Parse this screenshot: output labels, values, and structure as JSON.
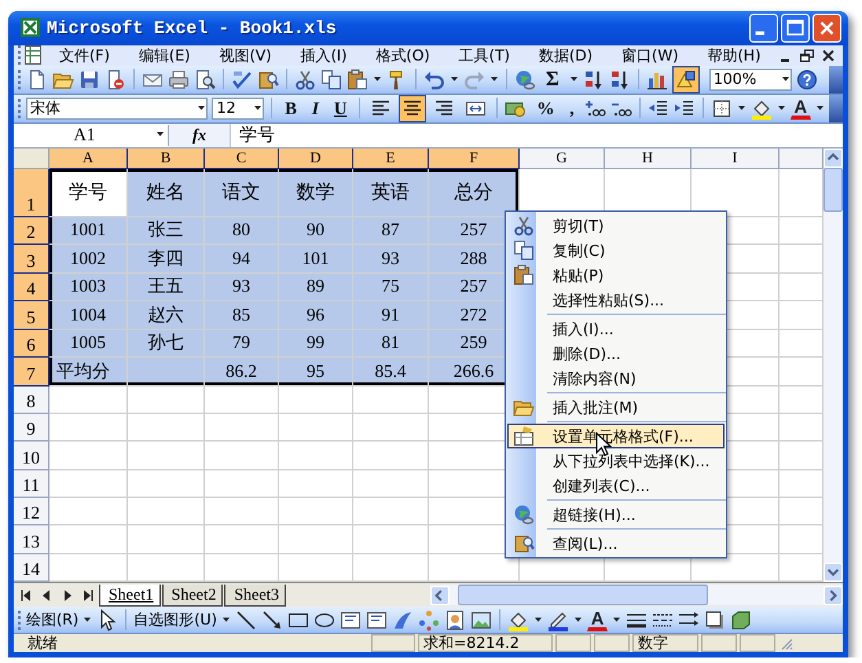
{
  "window": {
    "title": "Microsoft Excel - Book1.xls"
  },
  "menu_bar": {
    "items": [
      "文件(F)",
      "编辑(E)",
      "视图(V)",
      "插入(I)",
      "格式(O)",
      "工具(T)",
      "数据(D)",
      "窗口(W)",
      "帮助(H)"
    ]
  },
  "standard_toolbar": {
    "sum_symbol": "Σ",
    "drawing_pressed": true,
    "zoom": "100%"
  },
  "formatting_toolbar": {
    "font": "宋体",
    "size": "12",
    "bold": "B",
    "italic": "I",
    "underline": "U",
    "percent": "%",
    "comma": ",",
    "font_color_letter": "A",
    "align": [
      {
        "selected": false
      },
      {
        "selected": true
      },
      {
        "selected": false
      },
      {
        "selected": false
      }
    ]
  },
  "formula_bar": {
    "name_box": "A1",
    "fx": "fx",
    "value": "学号"
  },
  "sheet": {
    "columns": [
      {
        "label": "A",
        "selected": true
      },
      {
        "label": "B",
        "selected": true
      },
      {
        "label": "C",
        "selected": true
      },
      {
        "label": "D",
        "selected": true
      },
      {
        "label": "E",
        "selected": true
      },
      {
        "label": "F",
        "selected": true
      },
      {
        "label": "G",
        "selected": false
      },
      {
        "label": "H",
        "selected": false
      },
      {
        "label": "I",
        "selected": false
      }
    ],
    "rows": [
      {
        "header": "1",
        "selected": true,
        "cells": [
          {
            "text": "学号",
            "selected": false
          },
          {
            "text": "姓名",
            "selected": true
          },
          {
            "text": "语文",
            "selected": true
          },
          {
            "text": "数学",
            "selected": true
          },
          {
            "text": "英语",
            "selected": true
          },
          {
            "text": "总分",
            "selected": true
          }
        ]
      },
      {
        "header": "2",
        "selected": true,
        "cells": [
          {
            "text": "1001",
            "selected": true
          },
          {
            "text": "张三",
            "selected": true
          },
          {
            "text": "80",
            "selected": true
          },
          {
            "text": "90",
            "selected": true
          },
          {
            "text": "87",
            "selected": true
          },
          {
            "text": "257",
            "selected": true
          }
        ]
      },
      {
        "header": "3",
        "selected": true,
        "cells": [
          {
            "text": "1002",
            "selected": true
          },
          {
            "text": "李四",
            "selected": true
          },
          {
            "text": "94",
            "selected": true
          },
          {
            "text": "101",
            "selected": true
          },
          {
            "text": "93",
            "selected": true
          },
          {
            "text": "288",
            "selected": true
          }
        ]
      },
      {
        "header": "4",
        "selected": true,
        "cells": [
          {
            "text": "1003",
            "selected": true
          },
          {
            "text": "王五",
            "selected": true
          },
          {
            "text": "93",
            "selected": true
          },
          {
            "text": "89",
            "selected": true
          },
          {
            "text": "75",
            "selected": true
          },
          {
            "text": "257",
            "selected": true
          }
        ]
      },
      {
        "header": "5",
        "selected": true,
        "cells": [
          {
            "text": "1004",
            "selected": true
          },
          {
            "text": "赵六",
            "selected": true
          },
          {
            "text": "85",
            "selected": true
          },
          {
            "text": "96",
            "selected": true
          },
          {
            "text": "91",
            "selected": true
          },
          {
            "text": "272",
            "selected": true
          }
        ]
      },
      {
        "header": "6",
        "selected": true,
        "cells": [
          {
            "text": "1005",
            "selected": true
          },
          {
            "text": "孙七",
            "selected": true
          },
          {
            "text": "79",
            "selected": true
          },
          {
            "text": "99",
            "selected": true
          },
          {
            "text": "81",
            "selected": true
          },
          {
            "text": "259",
            "selected": true
          }
        ]
      },
      {
        "header": "7",
        "selected": true,
        "cells": [
          {
            "text": "平均分",
            "selected": true,
            "left_aligned": true
          },
          {
            "selected": true
          },
          {
            "text": "86.2",
            "selected": true
          },
          {
            "text": "95",
            "selected": true
          },
          {
            "text": "85.4",
            "selected": true
          },
          {
            "text": "266.6",
            "selected": true
          }
        ]
      },
      {
        "header": "8",
        "selected": false
      },
      {
        "header": "9",
        "selected": false
      },
      {
        "header": "10",
        "selected": false
      },
      {
        "header": "11",
        "selected": false
      },
      {
        "header": "12",
        "selected": false
      },
      {
        "header": "13",
        "selected": false
      },
      {
        "header": "14",
        "selected": false
      }
    ]
  },
  "context_menu": {
    "groups": [
      [
        {
          "label": "剪切(T)",
          "selected": false
        },
        {
          "label": "复制(C)",
          "selected": false
        },
        {
          "label": "粘贴(P)",
          "selected": false
        },
        {
          "label": "选择性粘贴(S)...",
          "selected": false
        }
      ],
      [
        {
          "label": "插入(I)...",
          "selected": false
        },
        {
          "label": "删除(D)...",
          "selected": false
        },
        {
          "label": "清除内容(N)",
          "selected": false
        }
      ],
      [
        {
          "label": "插入批注(M)",
          "selected": false
        }
      ],
      [
        {
          "label": "设置单元格格式(F)...",
          "selected": true
        },
        {
          "label": "从下拉列表中选择(K)...",
          "selected": false
        },
        {
          "label": "创建列表(C)...",
          "selected": false
        }
      ],
      [
        {
          "label": "超链接(H)...",
          "selected": false
        }
      ],
      [
        {
          "label": "查阅(L)...",
          "selected": false
        }
      ]
    ]
  },
  "sheet_tabs": [
    {
      "label": "Sheet1",
      "selected": true
    },
    {
      "label": "Sheet2",
      "selected": false
    },
    {
      "label": "Sheet3",
      "selected": false
    }
  ],
  "drawing_toolbar": {
    "draw_menu": "绘图(R)",
    "autoshapes": "自选图形(U)",
    "font_color_letter": "A"
  },
  "status_bar": {
    "status": "就绪",
    "sum": "求和=8214.2",
    "mode": "数字"
  }
}
